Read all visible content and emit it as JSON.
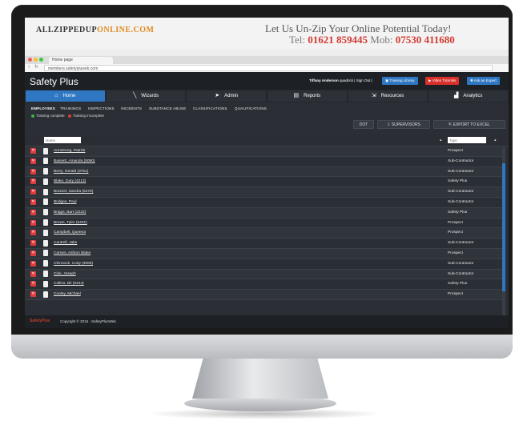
{
  "banner": {
    "logo_left": "ALLZIPPEDUP",
    "logo_right": "ONLINE.COM",
    "tagline": "Let Us Un-Zip Your Online Potential Today!",
    "phone_label": "Tel:",
    "phone": "01621 859445",
    "mobile_label": "Mob:",
    "mobile": "07530 411680"
  },
  "browser": {
    "tab_title": "Home page",
    "url": "members.safetypluweb.com"
  },
  "app": {
    "title": "Safety Plus",
    "user_text": "Tiffany Anderson",
    "user_suffix": "quadrick | Sign Out |",
    "buttons": {
      "training_library": "Training Library",
      "video_tutorials": "Video Tutorials",
      "ask_expert": "Ask an Expert"
    },
    "nav": [
      {
        "label": "Home",
        "icon": "home-icon"
      },
      {
        "label": "Wizards",
        "icon": "wand-icon"
      },
      {
        "label": "Admin",
        "icon": "cursor-icon"
      },
      {
        "label": "Reports",
        "icon": "document-icon"
      },
      {
        "label": "Resources",
        "icon": "external-icon"
      },
      {
        "label": "Analytics",
        "icon": "chart-icon"
      }
    ],
    "subtabs": [
      "EMPLOYEES",
      "TRAININGS",
      "INSPECTIONS",
      "INCIDENTS",
      "SUBSTANCE ABUSE",
      "CLASSIFICATIONS",
      "QUALIFICATIONS"
    ],
    "legend": {
      "complete": "Training complete",
      "incomplete": "Training incomplete"
    },
    "toolbar": {
      "dot": "DOT",
      "supervisors": "SUPERVISORS",
      "export": "EXPORT TO EXCEL"
    },
    "filters": {
      "name_placeholder": "Name",
      "type_placeholder": "Type"
    },
    "employees": [
      {
        "name": "Armstrong, Patrick",
        "type": "Prospect"
      },
      {
        "name": "Bassett, Amanda (5090)",
        "type": "Sub-Contractor"
      },
      {
        "name": "Berry, Gerald (3751)",
        "type": "Sub-Contractor"
      },
      {
        "name": "Blake, Gary (4213)",
        "type": "Safety Plus"
      },
      {
        "name": "Brazzel, Sandra (5275)",
        "type": "Sub-Contractor"
      },
      {
        "name": "Bridges, Paul",
        "type": "Sub-Contractor"
      },
      {
        "name": "Briggs, Bart (2222)",
        "type": "Safety Plus"
      },
      {
        "name": "Brown, Tyler (5401)",
        "type": "Prospect"
      },
      {
        "name": "Campbell, Queena",
        "type": "Prospect"
      },
      {
        "name": "Cantrell, Jake",
        "type": "Sub-Contractor"
      },
      {
        "name": "Carnes, Ashton Blake",
        "type": "Prospect"
      },
      {
        "name": "Chinnock, Cody (3089)",
        "type": "Sub-Contractor"
      },
      {
        "name": "Cink, Joseph",
        "type": "Sub-Contractor"
      },
      {
        "name": "Collins, Bil (5344)",
        "type": "Safety Plus"
      },
      {
        "name": "Cooley, Michael",
        "type": "Prospect"
      }
    ],
    "footer": {
      "logo": "SafetyPlus",
      "copyright": "Copyright © 2016 - SafetyPlusWeb"
    }
  },
  "colors": {
    "accent": "#2f77c2",
    "danger": "#e03c3c",
    "background": "#2b2f35"
  }
}
